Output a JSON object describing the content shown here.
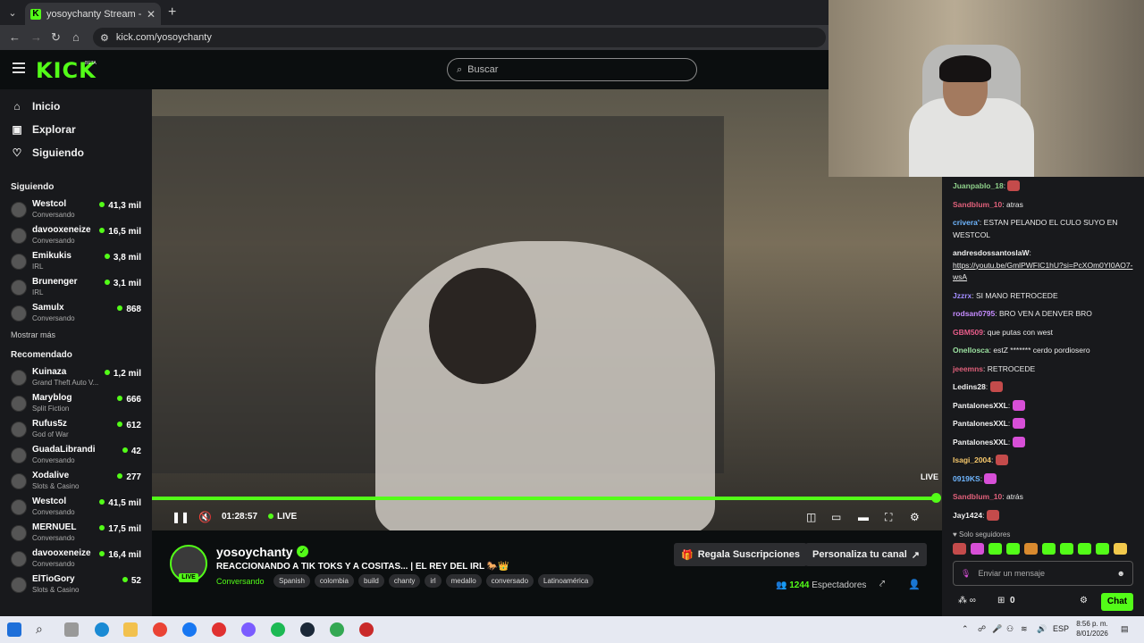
{
  "browser": {
    "tab_title": "yosoychanty Stream - Watch Live on Kick",
    "url": "kick.com/yosoychanty"
  },
  "header": {
    "logo": "KICK",
    "beta": "BETA",
    "search_placeholder": "Buscar"
  },
  "sidebar": {
    "nav": [
      {
        "label": "Inicio",
        "icon": "home-icon"
      },
      {
        "label": "Explorar",
        "icon": "compass-icon"
      },
      {
        "label": "Siguiendo",
        "icon": "heart-icon"
      }
    ],
    "following_title": "Siguiendo",
    "following": [
      {
        "name": "Westcol",
        "category": "Conversando",
        "viewers": "41,3 mil"
      },
      {
        "name": "davooxeneize",
        "category": "Conversando",
        "viewers": "16,5 mil"
      },
      {
        "name": "Emikukis",
        "category": "IRL",
        "viewers": "3,8 mil"
      },
      {
        "name": "Brunenger",
        "category": "IRL",
        "viewers": "3,1 mil"
      },
      {
        "name": "Samulx",
        "category": "Conversando",
        "viewers": "868"
      }
    ],
    "show_more": "Mostrar más",
    "recommended_title": "Recomendado",
    "recommended": [
      {
        "name": "Kuinaza",
        "category": "Grand Theft Auto V...",
        "viewers": "1,2 mil"
      },
      {
        "name": "Maryblog",
        "category": "Split Fiction",
        "viewers": "666"
      },
      {
        "name": "Rufus5z",
        "category": "God of War",
        "viewers": "612"
      },
      {
        "name": "GuadaLibrandi",
        "category": "Conversando",
        "viewers": "42"
      },
      {
        "name": "Xodalive",
        "category": "Slots & Casino",
        "viewers": "277"
      },
      {
        "name": "Westcol",
        "category": "Conversando",
        "viewers": "41,5 mil"
      },
      {
        "name": "MERNUEL",
        "category": "Conversando",
        "viewers": "17,5 mil"
      },
      {
        "name": "davooxeneize",
        "category": "Conversando",
        "viewers": "16,4 mil"
      },
      {
        "name": "ElTioGory",
        "category": "Slots & Casino",
        "viewers": "52"
      }
    ]
  },
  "player": {
    "live_badge": "LIVE",
    "time": "01:28:57",
    "live_label": "LIVE",
    "progress_percent": 99.5
  },
  "stream": {
    "channel": "yosoychanty",
    "avatar_live": "LIVE",
    "title": "REACCIONANDO A TIK TOKS Y A COSITAS... | EL REY DEL IRL 🐎👑",
    "category": "Conversando",
    "tags": [
      "Spanish",
      "colombia",
      "build",
      "chanty",
      "irl",
      "medallo",
      "conversado",
      "Latinoamérica"
    ],
    "gift_button": "Regala Suscripciones",
    "customize_button": "Personaliza tu canal",
    "viewers_count": "1244",
    "viewers_label": "Espectadores"
  },
  "chat": {
    "messages": [
      {
        "user": "Juanpablo_18",
        "color": "#8fd18b",
        "text": "",
        "emote": true
      },
      {
        "user": "Sandblum_10",
        "color": "#e0607a",
        "text": "atras"
      },
      {
        "user": "crivera'",
        "color": "#6fb6ff",
        "text": "ESTAN PELANDO EL CULO SUYO EN WESTCOL"
      },
      {
        "user": "andresdossantoslaW",
        "color": "#f0f0f0",
        "text": "https://youtu.be/GmlPWFIC1hU?si=PcXOm0YI0AO7-wsA"
      },
      {
        "user": "Jzzrx",
        "color": "#a18cff",
        "text": "SI MANO RETROCEDE"
      },
      {
        "user": "rodsan0795",
        "color": "#c58cff",
        "text": "BRO VEN A DENVER BRO"
      },
      {
        "user": "GBM509",
        "color": "#e85c8a",
        "text": "que putas con west"
      },
      {
        "user": "Onellosca",
        "color": "#9be0a0",
        "text": "estZ ******* cerdo pordiosero"
      },
      {
        "user": "jeeemns",
        "color": "#e0607a",
        "text": "RETROCEDE"
      },
      {
        "user": "Ledins28",
        "color": "#f0f0f0",
        "text": "",
        "emote": true
      },
      {
        "user": "PantalonesXXL",
        "color": "#f0f0f0",
        "text": "",
        "emote": true
      },
      {
        "user": "PantalonesXXL",
        "color": "#f0f0f0",
        "text": "",
        "emote": true
      },
      {
        "user": "PantalonesXXL",
        "color": "#f0f0f0",
        "text": "",
        "emote": true
      },
      {
        "user": "Isagi_2004",
        "color": "#f5c76b",
        "text": "",
        "emote": true
      },
      {
        "user": "0919KS",
        "color": "#6fb6ff",
        "text": "",
        "emote": true
      },
      {
        "user": "Sandblum_10",
        "color": "#e0607a",
        "text": "atrás"
      },
      {
        "user": "Jay1424",
        "color": "#f0f0f0",
        "text": "",
        "emote": true
      }
    ],
    "followers_only": "Solo seguidores",
    "input_placeholder": "Enviar un mensaje",
    "points": "0",
    "chat_button": "Chat"
  },
  "taskbar": {
    "lang": "ESP",
    "time": "8:56 p. m.",
    "date": "8/01/2026"
  },
  "colors": {
    "accent": "#53fc18",
    "background": "#0b0e0f",
    "sidebar": "#18191c"
  }
}
